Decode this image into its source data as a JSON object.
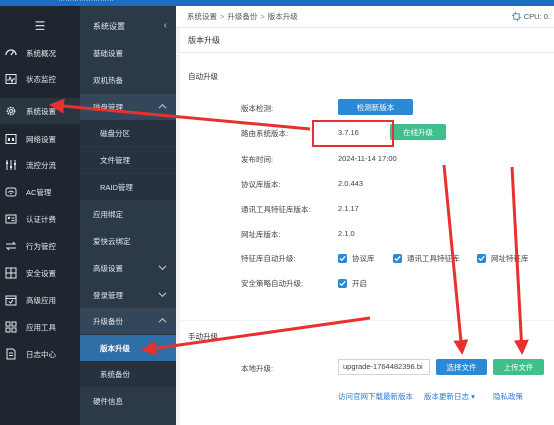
{
  "brand": {
    "text": "……………………"
  },
  "sidebar": {
    "toggle": "☰",
    "items": [
      {
        "label": "系统概况",
        "icon": "dashboard-icon"
      },
      {
        "label": "状态监控",
        "icon": "pulse-icon"
      },
      {
        "label": "系统设置",
        "icon": "gear-icon"
      },
      {
        "label": "网络设置",
        "icon": "network-icon"
      },
      {
        "label": "流控分流",
        "icon": "sliders-icon"
      },
      {
        "label": "AC管理",
        "icon": "wifi-icon"
      },
      {
        "label": "认证计费",
        "icon": "id-card-icon"
      },
      {
        "label": "行为管控",
        "icon": "exchange-icon"
      },
      {
        "label": "安全设置",
        "icon": "grid-icon"
      },
      {
        "label": "高级应用",
        "icon": "calendar-icon"
      },
      {
        "label": "应用工具",
        "icon": "apps-icon"
      },
      {
        "label": "日志中心",
        "icon": "document-icon"
      }
    ]
  },
  "submenu": {
    "header": "系统设置",
    "header_arrow": "‹",
    "items": [
      {
        "label": "基础设置",
        "kind": "plain"
      },
      {
        "label": "双机热备",
        "kind": "plain"
      },
      {
        "label": "磁盘管理",
        "kind": "group",
        "chevron": "up"
      },
      {
        "label": "磁盘分区",
        "kind": "child"
      },
      {
        "label": "文件管理",
        "kind": "child"
      },
      {
        "label": "RAID管理",
        "kind": "child"
      },
      {
        "label": "应用绑定",
        "kind": "plain"
      },
      {
        "label": "爱快云绑定",
        "kind": "plain"
      },
      {
        "label": "高级设置",
        "kind": "plain",
        "chevron": "down"
      },
      {
        "label": "登录管理",
        "kind": "plain",
        "chevron": "down"
      },
      {
        "label": "升级备份",
        "kind": "group",
        "chevron": "up"
      },
      {
        "label": "版本升级",
        "kind": "selected"
      },
      {
        "label": "系统备份",
        "kind": "child"
      },
      {
        "label": "硬件信息",
        "kind": "plain"
      }
    ]
  },
  "breadcrumb": {
    "items": [
      "系统设置",
      "升级备份",
      "版本升级"
    ],
    "sep": ">"
  },
  "cpu": {
    "label": "CPU: 0.",
    "icon": "chip-icon"
  },
  "panel": {
    "title": "版本升级",
    "auto_section": "自动升级",
    "rows": {
      "version_check": {
        "label": "版本检测:",
        "button": "检测新版本"
      },
      "current_version": {
        "label": "路由系统版本:",
        "value": "3.7.16",
        "button": "在线升级"
      },
      "release_time": {
        "label": "发布时间:",
        "value": "2024-11-14 17:00"
      },
      "protocol_db": {
        "label": "协议库版本:",
        "value": "2.0.443"
      },
      "comm_tool_db": {
        "label": "通讯工具特征库版本:",
        "value": "2.1.17"
      },
      "url_db": {
        "label": "网址库版本:",
        "value": "2.1.0"
      },
      "feature_auto": {
        "label": "特征库自动升级:",
        "options": [
          {
            "label": "协议库",
            "checked": true
          },
          {
            "label": "通讯工具特征库",
            "checked": true
          },
          {
            "label": "网址特征库",
            "checked": true
          }
        ]
      },
      "security_auto": {
        "label": "安全策略自动升级:",
        "option": "开启",
        "checked": true
      }
    },
    "manual_section": "手动升级",
    "local_upgrade": {
      "label": "本地升级:",
      "file_value": "upgrade-1764482396.bi",
      "select_button": "选择文件",
      "upload_button": "上传文件"
    },
    "links": [
      "访问官网下载最新版本",
      "版本更新日志 ▾",
      "隐私政策"
    ]
  },
  "colors": {
    "accent": "#2a8ad8",
    "success": "#3fbf8c",
    "sidebar_bg": "#1e2630",
    "annotation": "#e8312f"
  }
}
